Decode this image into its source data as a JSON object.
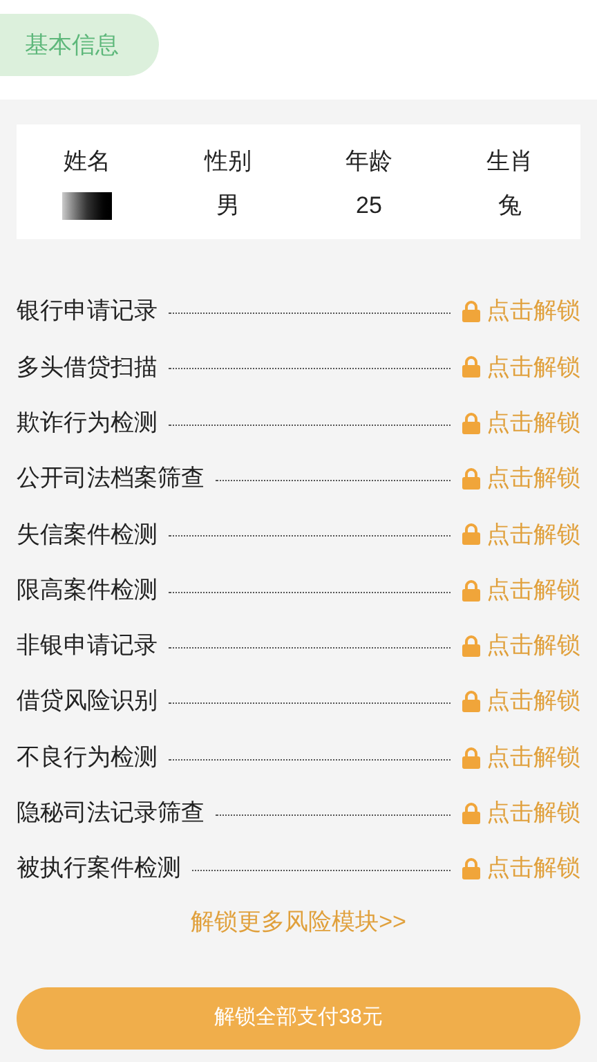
{
  "tab": {
    "label": "基本信息",
    "selected": true
  },
  "basic_info": {
    "columns": [
      {
        "label": "姓名",
        "kind": "redacted"
      },
      {
        "label": "性别",
        "kind": "text",
        "value": "男"
      },
      {
        "label": "年龄",
        "kind": "text",
        "value": "25"
      },
      {
        "label": "生肖",
        "kind": "text",
        "value": "兔"
      }
    ]
  },
  "modules": [
    {
      "name": "银行申请记录",
      "locked": true,
      "action": "点击解锁"
    },
    {
      "name": "多头借贷扫描",
      "locked": true,
      "action": "点击解锁"
    },
    {
      "name": "欺诈行为检测",
      "locked": true,
      "action": "点击解锁"
    },
    {
      "name": "公开司法档案筛查",
      "locked": true,
      "action": "点击解锁"
    },
    {
      "name": "失信案件检测",
      "locked": true,
      "action": "点击解锁"
    },
    {
      "name": "限高案件检测",
      "locked": true,
      "action": "点击解锁"
    },
    {
      "name": "非银申请记录",
      "locked": true,
      "action": "点击解锁"
    },
    {
      "name": "借贷风险识别",
      "locked": true,
      "action": "点击解锁"
    },
    {
      "name": "不良行为检测",
      "locked": true,
      "action": "点击解锁"
    },
    {
      "name": "隐秘司法记录筛查",
      "locked": true,
      "action": "点击解锁"
    },
    {
      "name": "被执行案件检测",
      "locked": true,
      "action": "点击解锁"
    }
  ],
  "more_link": "解锁更多风险模块>>",
  "pay_button": "解锁全部支付38元"
}
